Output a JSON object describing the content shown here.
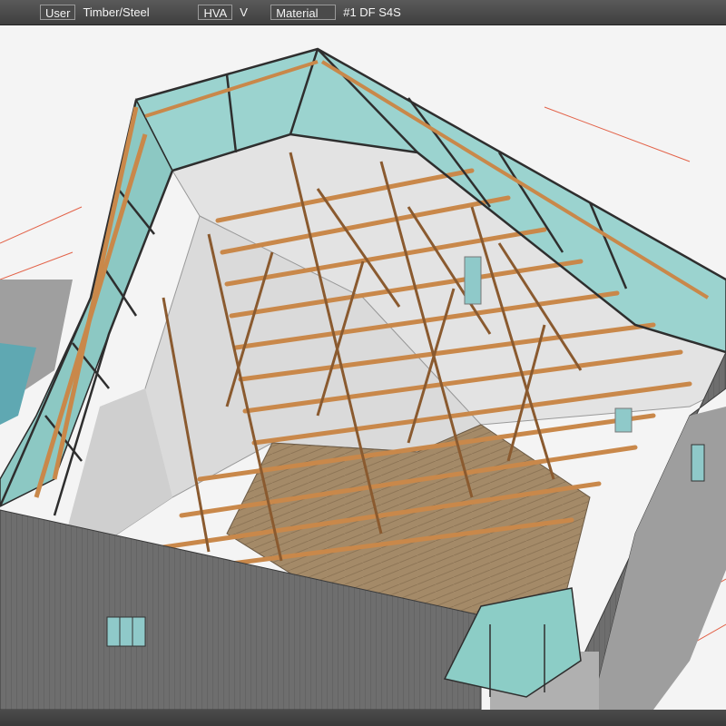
{
  "toolbar": {
    "view_button": "User",
    "view_value": "Timber/Steel",
    "hva_button": "HVA",
    "hva_value": "V",
    "material_button": "Material",
    "material_value": "#1 DF S4S"
  },
  "colors": {
    "toolbar_bg": "#4a4a4a",
    "timber": "#c9884a",
    "steel": "#3a3a3a",
    "glass": "#7fc9c4",
    "wall": "#6f6f6f",
    "grid_line": "#e0492b"
  },
  "viewport": {
    "content": "3d-model-render"
  }
}
